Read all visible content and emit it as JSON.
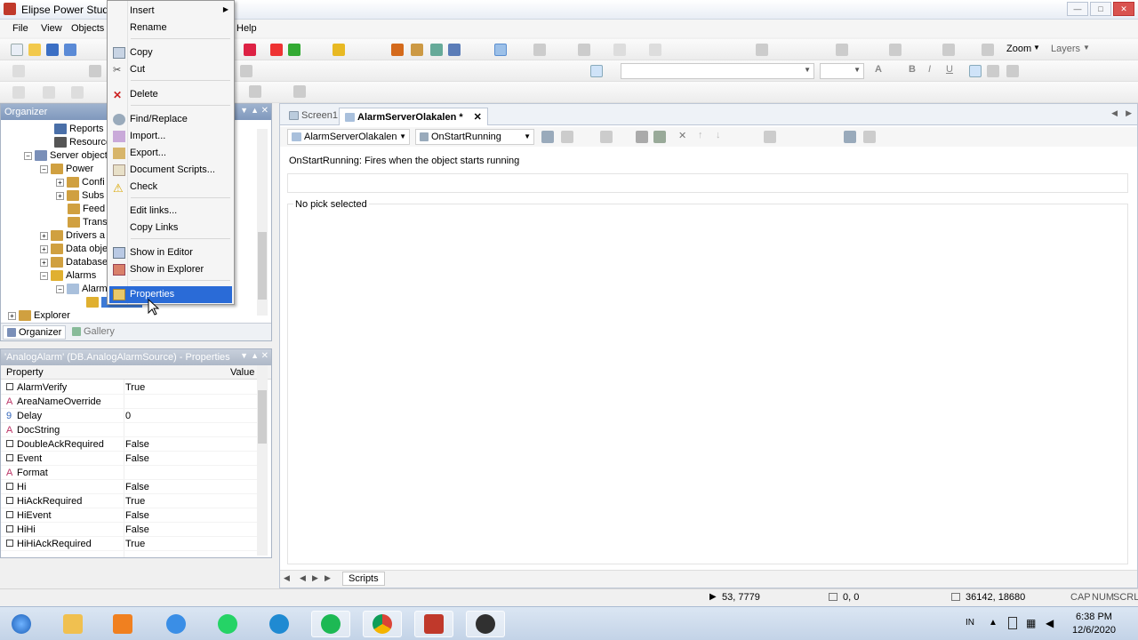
{
  "window": {
    "title": "Elipse Power Studio"
  },
  "menu": [
    "File",
    "View",
    "Objects",
    "Help"
  ],
  "toolbar": {
    "zoom_label": "Zoom",
    "layers_label": "Layers"
  },
  "context_menu": {
    "items": [
      {
        "label": "Insert",
        "icon": "none",
        "submenu": true
      },
      {
        "label": "Rename",
        "icon": "none"
      },
      {
        "label": "Copy",
        "icon": "copy-icon"
      },
      {
        "label": "Cut",
        "icon": "cut-icon"
      },
      {
        "label": "Delete",
        "icon": "delete-icon"
      },
      {
        "label": "Find/Replace",
        "icon": "find-icon"
      },
      {
        "label": "Import...",
        "icon": "import-icon"
      },
      {
        "label": "Export...",
        "icon": "export-icon"
      },
      {
        "label": "Document Scripts...",
        "icon": "scripts-icon"
      },
      {
        "label": "Check",
        "icon": "warning-icon"
      },
      {
        "label": "Edit links...",
        "icon": "none"
      },
      {
        "label": "Copy Links",
        "icon": "none"
      },
      {
        "label": "Show in Editor",
        "icon": "editor-icon"
      },
      {
        "label": "Show in Explorer",
        "icon": "explorer-icon"
      },
      {
        "label": "Properties",
        "icon": "properties-icon",
        "selected": true
      }
    ]
  },
  "organizer": {
    "title": "Organizer",
    "tree": [
      {
        "label": "Reports"
      },
      {
        "label": "Resource"
      },
      {
        "label": "Server object"
      },
      {
        "label": "Power"
      },
      {
        "label": "Confi"
      },
      {
        "label": "Subs"
      },
      {
        "label": "Feed"
      },
      {
        "label": "Trans"
      },
      {
        "label": "Drivers a"
      },
      {
        "label": "Data obje"
      },
      {
        "label": "Database"
      },
      {
        "label": "Alarms"
      },
      {
        "label": "Alarm"
      },
      {
        "label": "Explorer"
      }
    ],
    "tabs": [
      "Organizer",
      "Gallery"
    ]
  },
  "properties": {
    "title": "'AnalogAlarm' (DB.AnalogAlarmSource) - Properties",
    "col_property": "Property",
    "col_value": "Value",
    "rows": [
      {
        "name": "AlarmVerify",
        "value": "True"
      },
      {
        "name": "AreaNameOverride",
        "value": ""
      },
      {
        "name": "Delay",
        "value": "0"
      },
      {
        "name": "DocString",
        "value": ""
      },
      {
        "name": "DoubleAckRequired",
        "value": "False"
      },
      {
        "name": "Event",
        "value": "False"
      },
      {
        "name": "Format",
        "value": ""
      },
      {
        "name": "Hi",
        "value": "False"
      },
      {
        "name": "HiAckRequired",
        "value": "True"
      },
      {
        "name": "HiEvent",
        "value": "False"
      },
      {
        "name": "HiHi",
        "value": "False"
      },
      {
        "name": "HiHiAckRequired",
        "value": "True"
      }
    ]
  },
  "editor": {
    "tabs": [
      {
        "label": "Screen1"
      },
      {
        "label": "AlarmServerOlakalen *",
        "active": true
      }
    ],
    "object_combo": "AlarmServerOlakalen",
    "event_combo": "OnStartRunning",
    "description": "OnStartRunning: Fires when the object starts running",
    "pick_status": "No pick selected",
    "bottom_tab": "Scripts"
  },
  "statusbar": {
    "cursor_pos": "53, 7779",
    "size": "0, 0",
    "doc_size": "36142, 18680",
    "caps": "CAP",
    "num": "NUM",
    "scrl": "SCRL"
  },
  "taskbar": {
    "lang": "IN",
    "time": "6:38 PM",
    "date": "12/6/2020"
  }
}
